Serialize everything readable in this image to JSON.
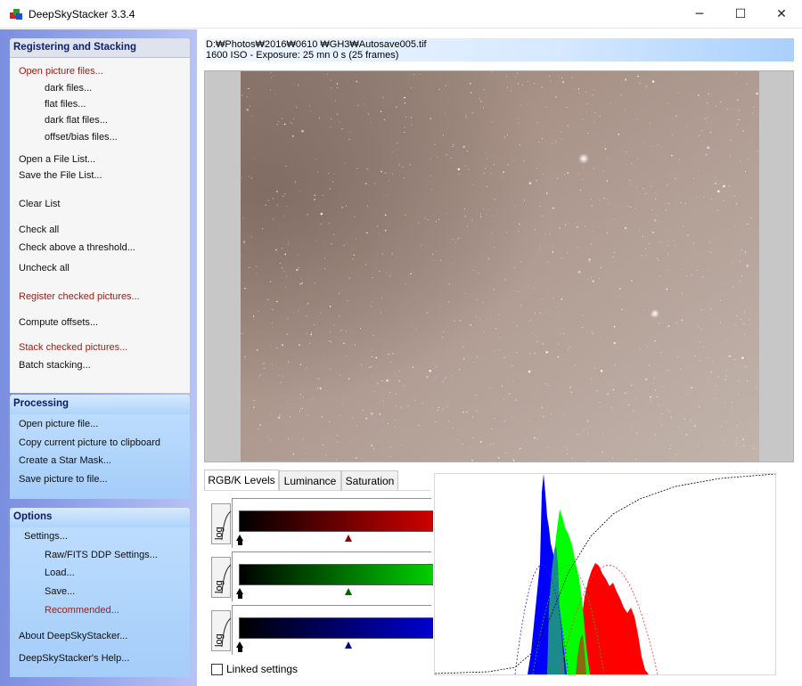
{
  "window": {
    "title": "DeepSkyStacker 3.3.4",
    "minimize_glyph": "─",
    "maximize_glyph": "☐",
    "close_glyph": "✕"
  },
  "sidebar": {
    "registering": {
      "title": "Registering and Stacking",
      "items": [
        "Open picture files...",
        "dark files...",
        "flat files...",
        "dark flat files...",
        "offset/bias files...",
        "Open a File List...",
        "Save the File List...",
        "Clear List",
        "Check all",
        "Check above a threshold...",
        "Uncheck all",
        "Register checked pictures...",
        "Compute offsets...",
        "Stack checked pictures...",
        "Batch stacking..."
      ]
    },
    "processing": {
      "title": "Processing",
      "items": [
        "Open picture file...",
        "Copy current picture to clipboard",
        "Create a Star Mask...",
        "Save picture to file..."
      ]
    },
    "options": {
      "title": "Options",
      "items": [
        "Settings...",
        "Raw/FITS DDP Settings...",
        "Load...",
        "Save...",
        "Recommended...",
        "About DeepSkyStacker...",
        "DeepSkyStacker's Help..."
      ]
    }
  },
  "info": {
    "path": "D:₩Photos₩2016₩0610          ₩GH3₩Autosave005.tif",
    "exposure": "1600 ISO - Exposure: 25 mn 0 s (25 frames)"
  },
  "tabs": [
    "RGB/K Levels",
    "Luminance",
    "Saturation"
  ],
  "levels": {
    "log_label": "log",
    "linked_label": "Linked settings",
    "linked_checked": false,
    "channels": [
      {
        "name": "red",
        "color": "#d00000",
        "mid_marker_color": "#8b0000",
        "black_point": 0.0,
        "mid_point": 0.55
      },
      {
        "name": "green",
        "color": "#00d000",
        "mid_marker_color": "#006400",
        "black_point": 0.0,
        "mid_point": 0.55
      },
      {
        "name": "blue",
        "color": "#0000d0",
        "mid_marker_color": "#00008b",
        "black_point": 0.0,
        "mid_point": 0.55
      }
    ]
  },
  "colors": {
    "accent_red_text": "#9b1c14",
    "histogram_red": "#ff0000",
    "histogram_green": "#00ff00",
    "histogram_blue": "#0000ff"
  }
}
